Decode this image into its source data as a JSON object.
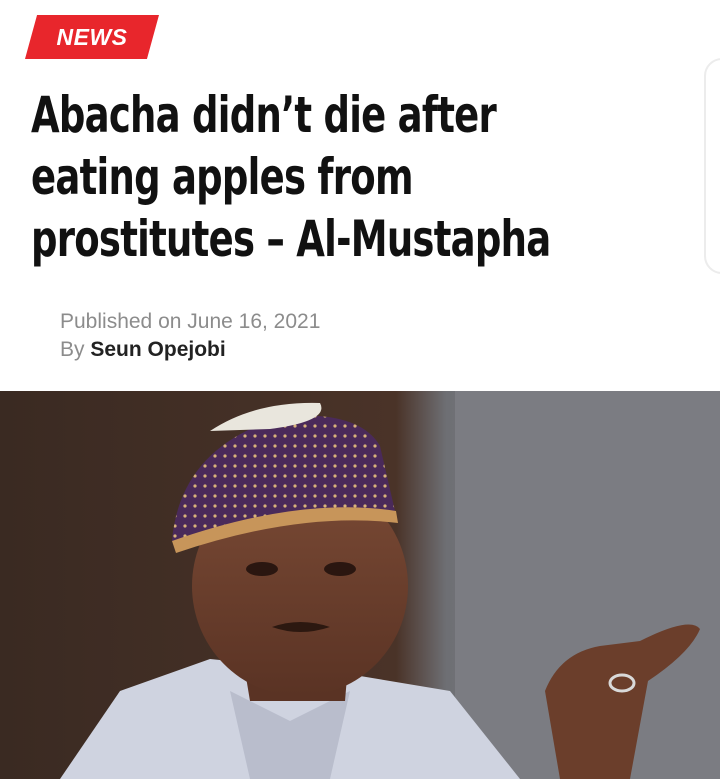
{
  "article": {
    "category": "NEWS",
    "headline_lines": [
      "Abacha didn’t die after",
      "eating apples from",
      "prostitutes – Al-Mustapha"
    ],
    "published_prefix": "Published on",
    "published_date": "June 16, 2021",
    "byline_prefix": "By",
    "author": "Seun Opejobi"
  },
  "colors": {
    "badge": "#e8262c",
    "headline": "#111111",
    "meta_gray": "#8c8c8c",
    "author": "#222222"
  }
}
